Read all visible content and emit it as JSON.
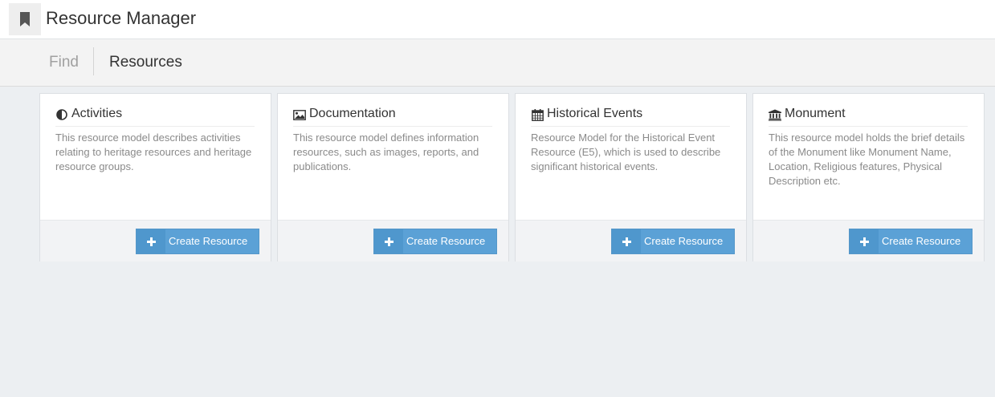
{
  "app": {
    "title": "Resource Manager",
    "logo_icon": "bookmark-icon"
  },
  "nav": {
    "tabs": [
      {
        "label": "Find"
      },
      {
        "label": "Resources"
      }
    ]
  },
  "cards": [
    {
      "title": "Activities",
      "icon": "half-circle-icon",
      "description": "This resource model describes activities relating to heritage resources and heritage resource groups.",
      "button_label": "Create Resource"
    },
    {
      "title": "Documentation",
      "icon": "image-icon",
      "description": "This resource model defines information resources, such as images, reports, and publications.",
      "button_label": "Create Resource"
    },
    {
      "title": "Historical Events",
      "icon": "calendar-icon",
      "description": "Resource Model for the Historical Event Resource (E5), which is used to describe significant historical events.",
      "button_label": "Create Resource"
    },
    {
      "title": "Monument",
      "icon": "institution-icon",
      "description": "This resource model holds the brief details of the Monument like Monument Name, Location, Religious features, Physical Description etc.",
      "button_label": "Create Resource"
    }
  ],
  "colors": {
    "button": "#5ba1d6",
    "button_icon_bg": "#4f97cd",
    "page_bg": "#eceff2"
  }
}
